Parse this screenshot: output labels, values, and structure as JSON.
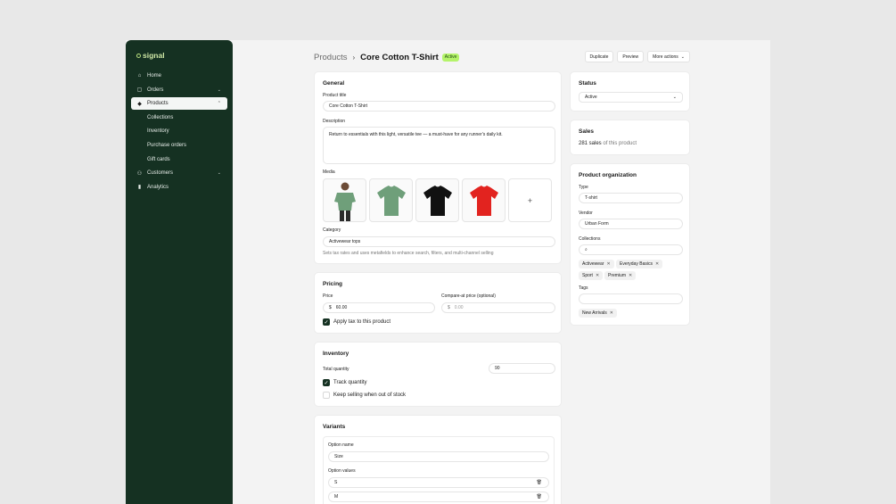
{
  "brand": {
    "name": "signal"
  },
  "sidebar": {
    "items": [
      {
        "label": "Home",
        "icon": "home-icon",
        "glyph": "⌂"
      },
      {
        "label": "Orders",
        "icon": "bag-icon",
        "glyph": "▢",
        "chevron": "⌄"
      },
      {
        "label": "Products",
        "icon": "tag-icon",
        "glyph": "◆",
        "chevron": "⌃"
      },
      {
        "label": "Collections"
      },
      {
        "label": "Inventory"
      },
      {
        "label": "Purchase orders"
      },
      {
        "label": "Gift cards"
      },
      {
        "label": "Customers",
        "icon": "users-icon",
        "glyph": "⚇",
        "chevron": "⌄"
      },
      {
        "label": "Analytics",
        "icon": "chart-icon",
        "glyph": "▮"
      }
    ]
  },
  "header": {
    "breadcrumb": "Products",
    "separator": "›",
    "title": "Core Cotton T-Shirt",
    "badge": "Active",
    "actions": {
      "duplicate": "Duplicate",
      "preview": "Preview",
      "more": "More actions",
      "more_chevron": "⌄"
    }
  },
  "general": {
    "heading": "General",
    "title_label": "Product title",
    "title_value": "Core Cotton T-Shirt",
    "description_label": "Description",
    "description_value": "Return to essentials with this light, versatile tee — a must-have for any runner's daily kit.",
    "media_label": "Media",
    "media_add": "+",
    "media_colors": [
      "#6f9f7a",
      "#111111",
      "#e2231f"
    ],
    "category_label": "Category",
    "category_value": "Activewear tops",
    "category_helper": "Sets tax rates and uses metafields to enhance search, filters, and multi-channel selling"
  },
  "pricing": {
    "heading": "Pricing",
    "price_label": "Price",
    "currency": "$",
    "price_value": "60.00",
    "compare_label": "Compare-at price (optional)",
    "compare_placeholder": "0.00",
    "tax_label": "Apply tax to this product",
    "check": "✓"
  },
  "inventory": {
    "heading": "Inventory",
    "total_label": "Total quantity",
    "total_value": "90",
    "track_label": "Track quantity",
    "keep_label": "Keep selling when out of stock"
  },
  "variants": {
    "heading": "Variants",
    "option_name_label": "Option name",
    "option_name_value": "Size",
    "option_values_label": "Option values",
    "values": [
      "S",
      "M"
    ],
    "trash_glyph": "🗑"
  },
  "status": {
    "heading": "Status",
    "value": "Active",
    "chevron": "⌄"
  },
  "sales": {
    "heading": "Sales",
    "count": "281 sales",
    "suffix": "of this product"
  },
  "organization": {
    "heading": "Product organization",
    "type_label": "Type",
    "type_value": "T-shirt",
    "vendor_label": "Vendor",
    "vendor_value": "Urban Form",
    "collections_label": "Collections",
    "search_glyph": "⌕",
    "collections": [
      "Activewear",
      "Everyday Basics",
      "Sport",
      "Premium"
    ],
    "tags_label": "Tags",
    "tags": [
      "New Arrivals"
    ],
    "remove_glyph": "✕"
  },
  "colors": {
    "sidebar": "#153122",
    "accent": "#b4f36a",
    "logo": "#cfe8a6"
  }
}
